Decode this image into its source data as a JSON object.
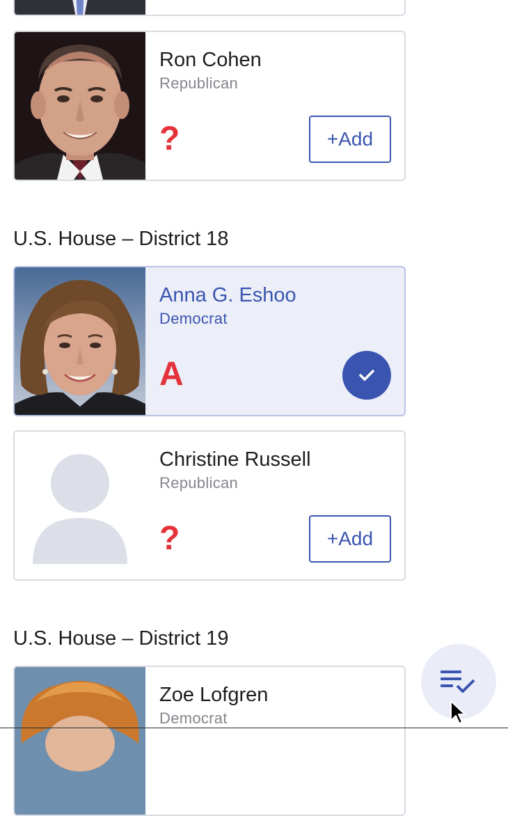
{
  "candidates": {
    "prev": {
      "bottom": true
    },
    "ron": {
      "name": "Ron Cohen",
      "party": "Republican",
      "grade": "?",
      "add_label": "+Add"
    },
    "anna": {
      "name": "Anna G. Eshoo",
      "party": "Democrat",
      "grade": "A"
    },
    "christine": {
      "name": "Christine Russell",
      "party": "Republican",
      "grade": "?",
      "add_label": "+Add"
    },
    "zoe": {
      "name": "Zoe Lofgren",
      "party": "Democrat"
    }
  },
  "sections": {
    "district18": "U.S. House – District 18",
    "district19": "U.S. House – District 19"
  },
  "icons": {
    "selected": "check-icon",
    "fab": "playlist-check-icon",
    "placeholder": "person-placeholder-icon"
  },
  "colors": {
    "accent": "#3a55b0",
    "grade": "#e3323a",
    "selected_bg": "#eceef8"
  }
}
